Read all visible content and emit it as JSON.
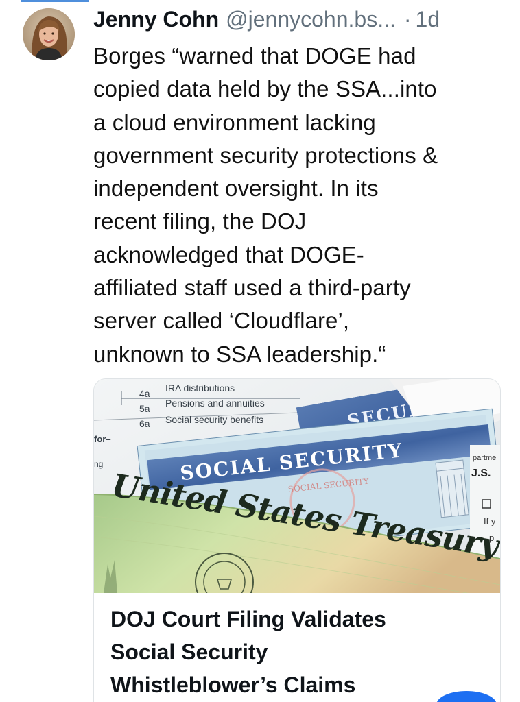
{
  "post": {
    "author": {
      "display_name": "Jenny Cohn",
      "handle": "@jennycohn.bs..."
    },
    "separator": "·",
    "timestamp": "1d",
    "text_lines": [
      "Borges “warned that DOGE had",
      "copied data held by the SSA...into",
      "a cloud environment lacking",
      "government security protections &",
      "independent oversight. In its",
      "recent filing, the DOJ",
      "acknowledged that DOGE-",
      "affiliated staff used a third-party",
      "server called ‘Cloudflare’,",
      "unknown to SSA leadership.“"
    ],
    "avatar_icon": "avatar-photo"
  },
  "link_card": {
    "image": {
      "form_lines": [
        {
          "num": "4a",
          "label": "IRA distributions"
        },
        {
          "num": "5a",
          "label": "Pensions and annuities"
        },
        {
          "num": "6a",
          "label": "Social security benefits"
        }
      ],
      "form_left_labels": [
        "for–",
        "ng"
      ],
      "card_heading": "SOCIAL SECURITY",
      "card_seal_text": "SOCIAL SECURITY",
      "card_top_text": "SECUR",
      "treasury_text": "United States Treasury",
      "right_edge_text": [
        "partme",
        "J.S.",
        "If y",
        "p"
      ]
    },
    "title_lines": [
      "DOJ Court Filing Validates",
      "Social Security",
      "Whistleblower’s Claims"
    ]
  },
  "colors": {
    "accent": "#4f8fdc",
    "secondary_text": "#62707c",
    "card_border": "#dfe3e6"
  }
}
